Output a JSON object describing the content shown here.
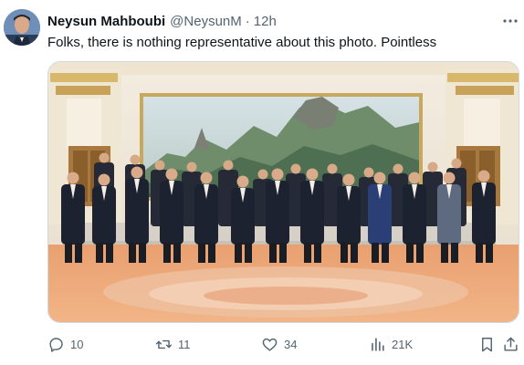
{
  "tweet": {
    "author_name": "Neysun Mahboubi",
    "author_handle": "@NeysunM",
    "separator": "·",
    "time": "12h",
    "text": "Folks, there is nothing representative about this photo. Pointless",
    "avatar_icon": "profile-photo",
    "more_icon": "more-dots-icon"
  },
  "media": {
    "description_icon": "group-photo-image"
  },
  "actions": {
    "replies": "10",
    "retweets": "11",
    "likes": "34",
    "views": "21K",
    "reply_icon": "reply-icon",
    "retweet_icon": "retweet-icon",
    "like_icon": "heart-icon",
    "views_icon": "views-chart-icon",
    "bookmark_icon": "bookmark-icon",
    "share_icon": "share-icon"
  },
  "colors": {
    "text_primary": "#0f1419",
    "text_secondary": "#536471",
    "border": "#cfd9de"
  }
}
